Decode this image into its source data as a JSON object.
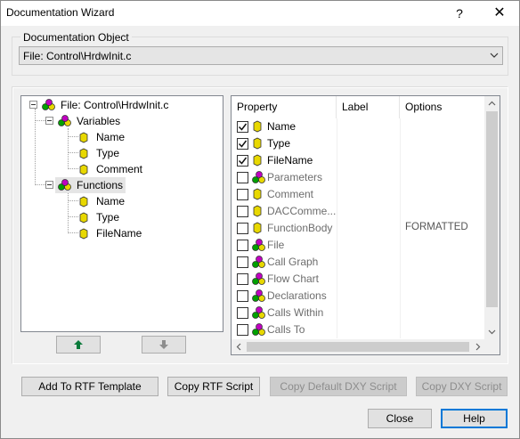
{
  "window": {
    "title": "Documentation Wizard",
    "help_glyph": "?",
    "close_glyph": "✕"
  },
  "doc_object": {
    "label": "Documentation Object",
    "selected": "File: Control\\HrdwInit.c"
  },
  "tree": {
    "root": "File: Control\\HrdwInit.c",
    "variables": "Variables",
    "var_items": [
      "Name",
      "Type",
      "Comment"
    ],
    "functions": "Functions",
    "func_items": [
      "Name",
      "Type",
      "FileName"
    ]
  },
  "list": {
    "columns": [
      "Property",
      "Label",
      "Options"
    ],
    "rows": [
      {
        "property": "Name",
        "checked": true,
        "icon": "key-icon",
        "option": ""
      },
      {
        "property": "Type",
        "checked": true,
        "icon": "key-icon",
        "option": ""
      },
      {
        "property": "FileName",
        "checked": true,
        "icon": "key-icon",
        "option": ""
      },
      {
        "property": "Parameters",
        "checked": false,
        "icon": "class-icon",
        "option": ""
      },
      {
        "property": "Comment",
        "checked": false,
        "icon": "key-icon",
        "option": ""
      },
      {
        "property": "DACComme...",
        "checked": false,
        "icon": "key-icon",
        "option": ""
      },
      {
        "property": "FunctionBody",
        "checked": false,
        "icon": "key-icon",
        "option": "FORMATTED"
      },
      {
        "property": "File",
        "checked": false,
        "icon": "class-icon",
        "option": ""
      },
      {
        "property": "Call Graph",
        "checked": false,
        "icon": "class-icon",
        "option": ""
      },
      {
        "property": "Flow Chart",
        "checked": false,
        "icon": "class-icon",
        "option": ""
      },
      {
        "property": "Declarations",
        "checked": false,
        "icon": "class-icon",
        "option": ""
      },
      {
        "property": "Calls Within",
        "checked": false,
        "icon": "class-icon",
        "option": ""
      },
      {
        "property": "Calls To",
        "checked": false,
        "icon": "class-icon",
        "option": ""
      }
    ]
  },
  "buttons": {
    "add_rtf": "Add To RTF Template",
    "copy_rtf": "Copy RTF Script",
    "copy_default_dxy": "Copy Default DXY Script",
    "copy_dxy": "Copy DXY Script",
    "close": "Close",
    "help": "Help"
  },
  "colors": {
    "accent": "#0078d7",
    "key_yellow": "#e8d800",
    "class_magenta": "#c000c0",
    "class_green": "#00a000",
    "arrow_green": "#0a7a3a"
  }
}
